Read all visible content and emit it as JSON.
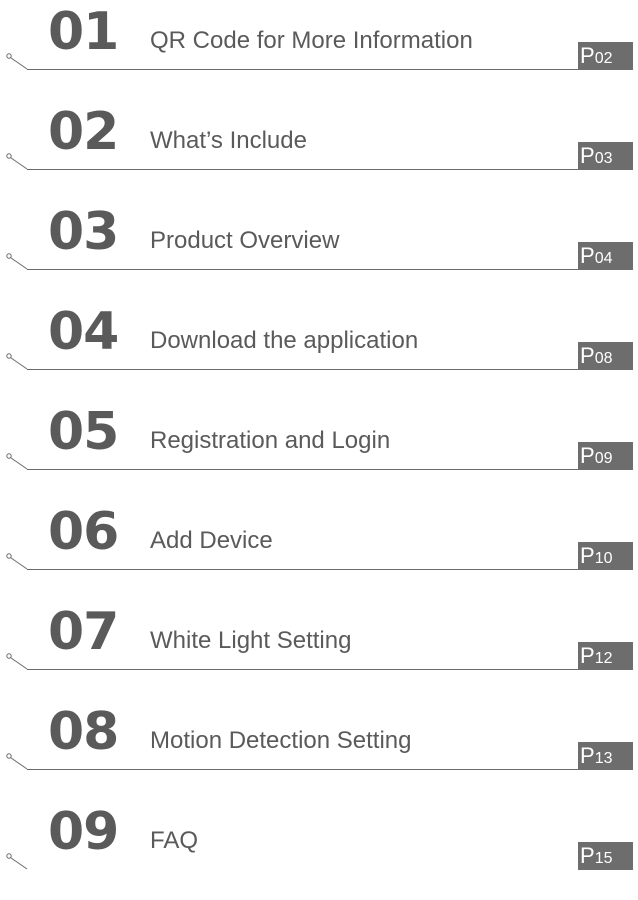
{
  "colors": {
    "text": "#5a5a5a",
    "rule": "#6a6a6a",
    "badge_bg": "#6d6d6d",
    "badge_text": "#ffffff"
  },
  "icons": {
    "leader": "line-leader-icon"
  },
  "toc": {
    "items": [
      {
        "number": "01",
        "title": "QR Code for More Information",
        "page_prefix": "P",
        "page_num": "02"
      },
      {
        "number": "02",
        "title": "What’s Include",
        "page_prefix": "P",
        "page_num": "03"
      },
      {
        "number": "03",
        "title": "Product Overview",
        "page_prefix": "P",
        "page_num": "04"
      },
      {
        "number": "04",
        "title": "Download the application",
        "page_prefix": "P",
        "page_num": "08"
      },
      {
        "number": "05",
        "title": "Registration and Login",
        "page_prefix": "P",
        "page_num": "09"
      },
      {
        "number": "06",
        "title": "Add Device",
        "page_prefix": "P",
        "page_num": "10"
      },
      {
        "number": "07",
        "title": "White Light Setting",
        "page_prefix": "P",
        "page_num": "12"
      },
      {
        "number": "08",
        "title": "Motion Detection Setting",
        "page_prefix": "P",
        "page_num": "13"
      },
      {
        "number": "09",
        "title": "FAQ",
        "page_prefix": "P",
        "page_num": "15"
      }
    ]
  }
}
